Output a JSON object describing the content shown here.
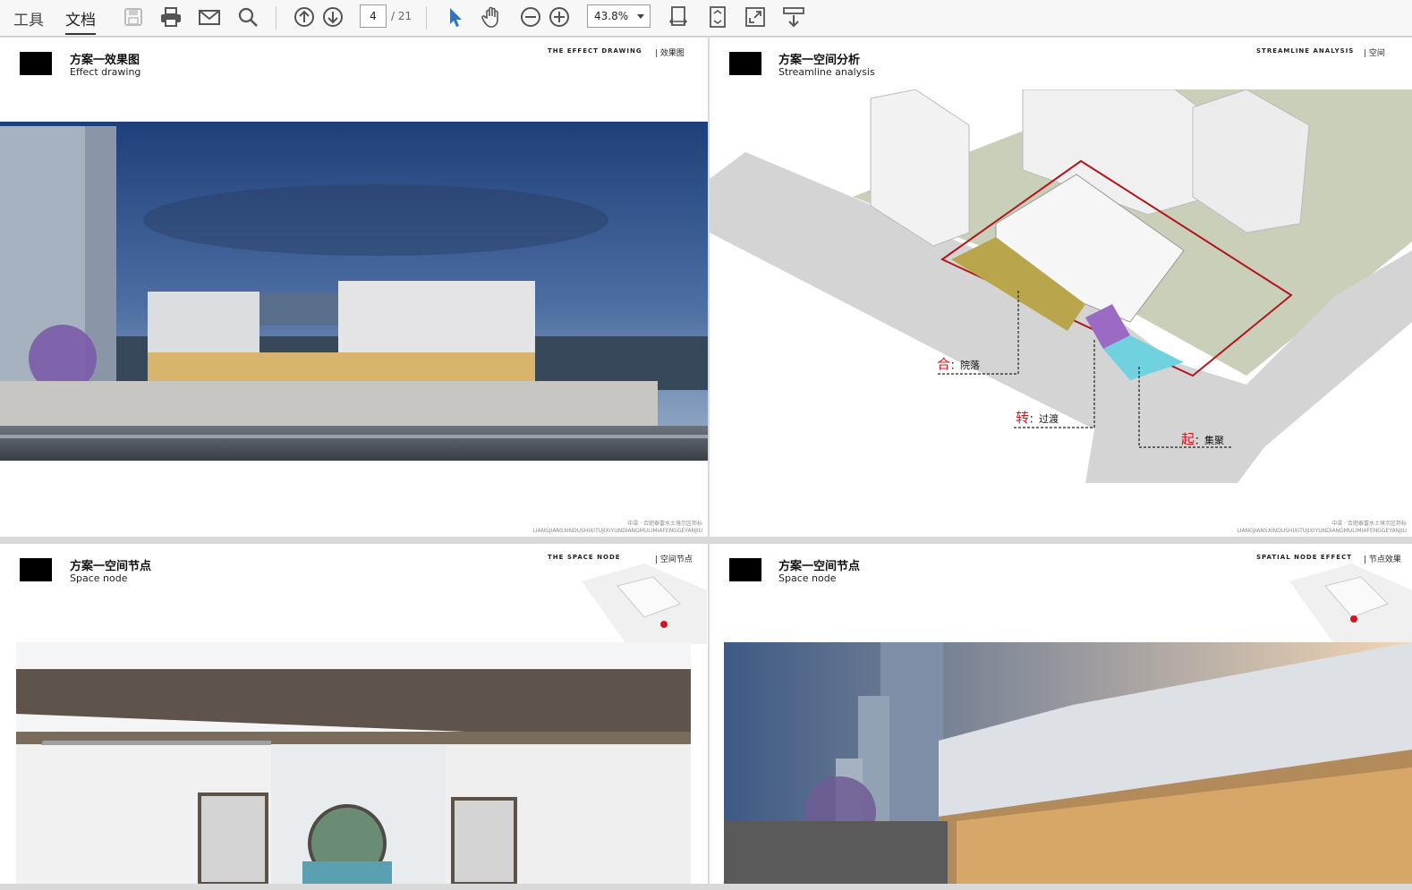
{
  "toolbar": {
    "tab_tools": "工具",
    "tab_document": "文档",
    "page_current": "4",
    "page_total": "/ 21",
    "zoom": "43.8%",
    "icons": [
      "save-icon",
      "print-icon",
      "email-icon",
      "search-icon",
      "prev-page-icon",
      "next-page-icon",
      "select-cursor-icon",
      "hand-icon",
      "zoom-out-icon",
      "zoom-in-icon",
      "fit-width-icon",
      "fit-page-icon",
      "fullscreen-icon",
      "download-icon"
    ]
  },
  "pages": [
    {
      "title": "方案一效果图",
      "subtitle": "Effect drawing",
      "tag_en": "THE EFFECT DRAWING",
      "tag_cn": "| 效果图",
      "footer_cn": "中梁 · 合肥泰富水土境示区邦标",
      "footer_en": "LIANGJIANSXINDUSHIXITUJIXIYUNDIANGMULIMIAFENGGEYANJIU"
    },
    {
      "title": "方案一空间分析",
      "subtitle": "Streamline analysis",
      "tag_en": "STREAMLINE ANALYSIS",
      "tag_cn": "| 空间",
      "labels": [
        {
          "key": "合",
          "text": "院落"
        },
        {
          "key": "转",
          "text": "过渡"
        },
        {
          "key": "起",
          "text": "集聚"
        }
      ],
      "footer_cn": "中梁 · 合肥泰富水土境示区邦标",
      "footer_en": "LIANGJIANSXINDUSHIXITUJIXIYUNDIANGMULIMIAFENGGEYANJIU"
    },
    {
      "title": "方案一空间节点",
      "subtitle": "Space node",
      "tag_en": "THE SPACE NODE",
      "tag_cn": "| 空间节点"
    },
    {
      "title": "方案一空间节点",
      "subtitle": "Space node",
      "tag_en": "SPATIAL NODE EFFECT",
      "tag_cn": "| 节点效果"
    }
  ],
  "colors": {
    "accent_red": "#d0181e",
    "toolbar_bg": "#f7f7f7",
    "viewer_bg": "#d9d9d9"
  }
}
